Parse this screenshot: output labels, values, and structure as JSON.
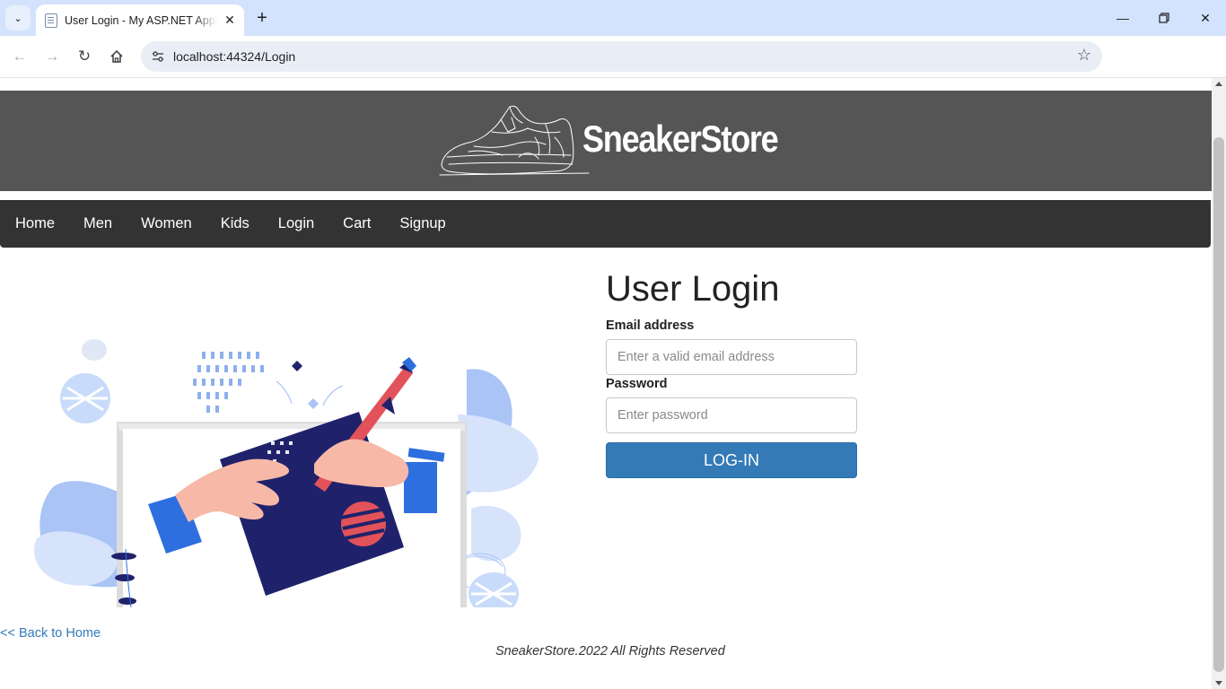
{
  "browser": {
    "tab_title": "User Login - My ASP.NET Application",
    "url": "localhost:44324/Login"
  },
  "site": {
    "brand": "SneakerStore",
    "nav": [
      "Home",
      "Men",
      "Women",
      "Kids",
      "Login",
      "Cart",
      "Signup"
    ]
  },
  "login": {
    "title": "User Login",
    "email_label": "Email address",
    "email_placeholder": "Enter a valid email address",
    "password_label": "Password",
    "password_placeholder": "Enter password",
    "button_label": "LOG-IN"
  },
  "back_link": "<< Back to Home",
  "footer": "SneakerStore.2022 All Rights Reserved",
  "colors": {
    "banner": "#555555",
    "navbar": "#333333",
    "accent": "#337ab7"
  }
}
